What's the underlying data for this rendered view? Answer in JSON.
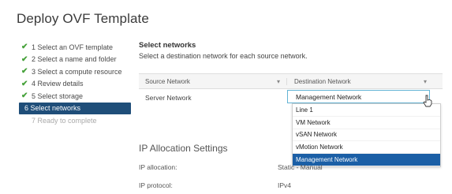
{
  "title": "Deploy OVF Template",
  "steps": [
    {
      "label": "1 Select an OVF template",
      "state": "done"
    },
    {
      "label": "2 Select a name and folder",
      "state": "done"
    },
    {
      "label": "3 Select a compute resource",
      "state": "done"
    },
    {
      "label": "4 Review details",
      "state": "done"
    },
    {
      "label": "5 Select storage",
      "state": "done"
    },
    {
      "label": "6 Select networks",
      "state": "active"
    },
    {
      "label": "7 Ready to complete",
      "state": "disabled"
    }
  ],
  "check_glyph": "✔",
  "main": {
    "heading": "Select networks",
    "subheading": "Select a destination network for each source network."
  },
  "grid": {
    "col_source": "Source Network",
    "col_destination": "Destination Network",
    "filter_icon": "filter-icon",
    "row_source": "Server Network",
    "selected_value": "Management Network"
  },
  "dropdown_options": [
    "Line 1",
    "VM Network",
    "vSAN Network",
    "vMotion Network",
    "Management Network"
  ],
  "dropdown_selected_index": 4,
  "ip": {
    "title": "IP Allocation Settings",
    "allocation_label": "IP allocation:",
    "allocation_value": "Static - Manual",
    "protocol_label": "IP protocol:",
    "protocol_value": "IPv4"
  },
  "colors": {
    "accent": "#1f4e79",
    "check": "#46a13a",
    "selected": "#1b5fa6"
  }
}
